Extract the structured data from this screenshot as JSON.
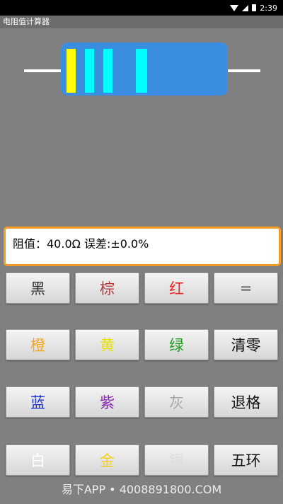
{
  "status_bar": {
    "time": "2:39"
  },
  "app": {
    "title": "电阻值计算器"
  },
  "resistor": {
    "body_color": "#3b8de0",
    "bands": [
      {
        "color": "#ffff00"
      },
      {
        "color": "#00ffff"
      },
      {
        "color": "#00ffff"
      },
      {
        "color": "#00ffff"
      }
    ]
  },
  "display": {
    "text": "阻值：40.0Ω 误差:±0.0%"
  },
  "buttons": [
    {
      "label": "黑",
      "color": "#333333"
    },
    {
      "label": "棕",
      "color": "#b23b3b"
    },
    {
      "label": "红",
      "color": "#ee2222"
    },
    {
      "label": "=",
      "color": "#555555"
    },
    {
      "label": "橙",
      "color": "#f5a623"
    },
    {
      "label": "黄",
      "color": "#e8e010"
    },
    {
      "label": "绿",
      "color": "#22a022"
    },
    {
      "label": "清零",
      "color": "#111111"
    },
    {
      "label": "蓝",
      "color": "#2233cc"
    },
    {
      "label": "紫",
      "color": "#8a2ab0"
    },
    {
      "label": "灰",
      "color": "#a8a8a8"
    },
    {
      "label": "退格",
      "color": "#111111"
    },
    {
      "label": "白",
      "color": "#ffffff"
    },
    {
      "label": "金",
      "color": "#f0d020"
    },
    {
      "label": "银",
      "color": "#dddddd"
    },
    {
      "label": "五环",
      "color": "#111111"
    }
  ],
  "watermark": "易下APP • 4008891800.COM"
}
